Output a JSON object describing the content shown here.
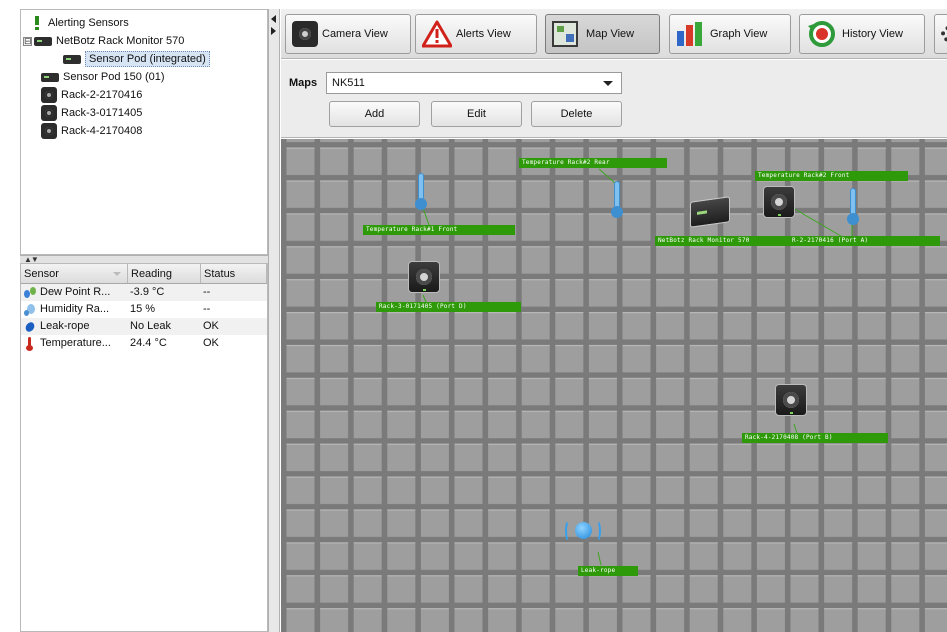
{
  "tree": {
    "items": [
      {
        "label": "Alerting Sensors",
        "icon": "alert-exclamation-icon"
      },
      {
        "label": "NetBotz Rack Monitor 570",
        "icon": "netbotz-device-icon",
        "expander": "⊟"
      },
      {
        "label": "Sensor Pod (integrated)",
        "icon": "netbotz-device-icon"
      },
      {
        "label": "Sensor Pod 150 (01)",
        "icon": "netbotz-device-icon"
      },
      {
        "label": "Rack-2-2170416",
        "icon": "camera-icon"
      },
      {
        "label": "Rack-3-0171405",
        "icon": "camera-icon"
      },
      {
        "label": "Rack-4-2170408",
        "icon": "camera-icon"
      }
    ]
  },
  "splitter": {
    "arrows": "▲▼"
  },
  "sensor_table": {
    "headers": {
      "sensor": "Sensor",
      "reading": "Reading",
      "status": "Status"
    },
    "rows": [
      {
        "sensor": "Dew Point R...",
        "reading": "-3.9 °C",
        "status": "--",
        "icon": "dew-point-icon"
      },
      {
        "sensor": "Humidity Ra...",
        "reading": "15 %",
        "status": "--",
        "icon": "humidity-icon"
      },
      {
        "sensor": "Leak-rope",
        "reading": "No Leak",
        "status": "OK",
        "icon": "leak-drop-icon"
      },
      {
        "sensor": "Temperature...",
        "reading": "24.4 °C",
        "status": "OK",
        "icon": "thermometer-icon"
      }
    ]
  },
  "toolbar": {
    "camera_view": "Camera View",
    "alerts_view": "Alerts View",
    "map_view": "Map View",
    "graph_view": "Graph View",
    "history_view": "History View"
  },
  "maps": {
    "label": "Maps",
    "selected": "NK511",
    "add": "Add",
    "edit": "Edit",
    "delete": "Delete"
  },
  "map_items": {
    "temp_rack1_front": "Temperature Rack#1 Front",
    "temp_rack2_rear": "Temperature Rack#2 Rear",
    "temp_rack2_front": "Temperature Rack#2 Front",
    "netbotz": "NetBotz Rack Monitor 570",
    "cam_rack2": "R-2-2170416 (Port A)",
    "cam_rack3": "Rack-3-0171405 (Port D)",
    "cam_rack4": "Rack-4-2170408 (Port B)",
    "leak_rope": "Leak-rope"
  },
  "colors": {
    "label_green": "#2e9a0a",
    "grid_gray": "#8f8f8f",
    "selection_blue": "#d6e4f4"
  }
}
